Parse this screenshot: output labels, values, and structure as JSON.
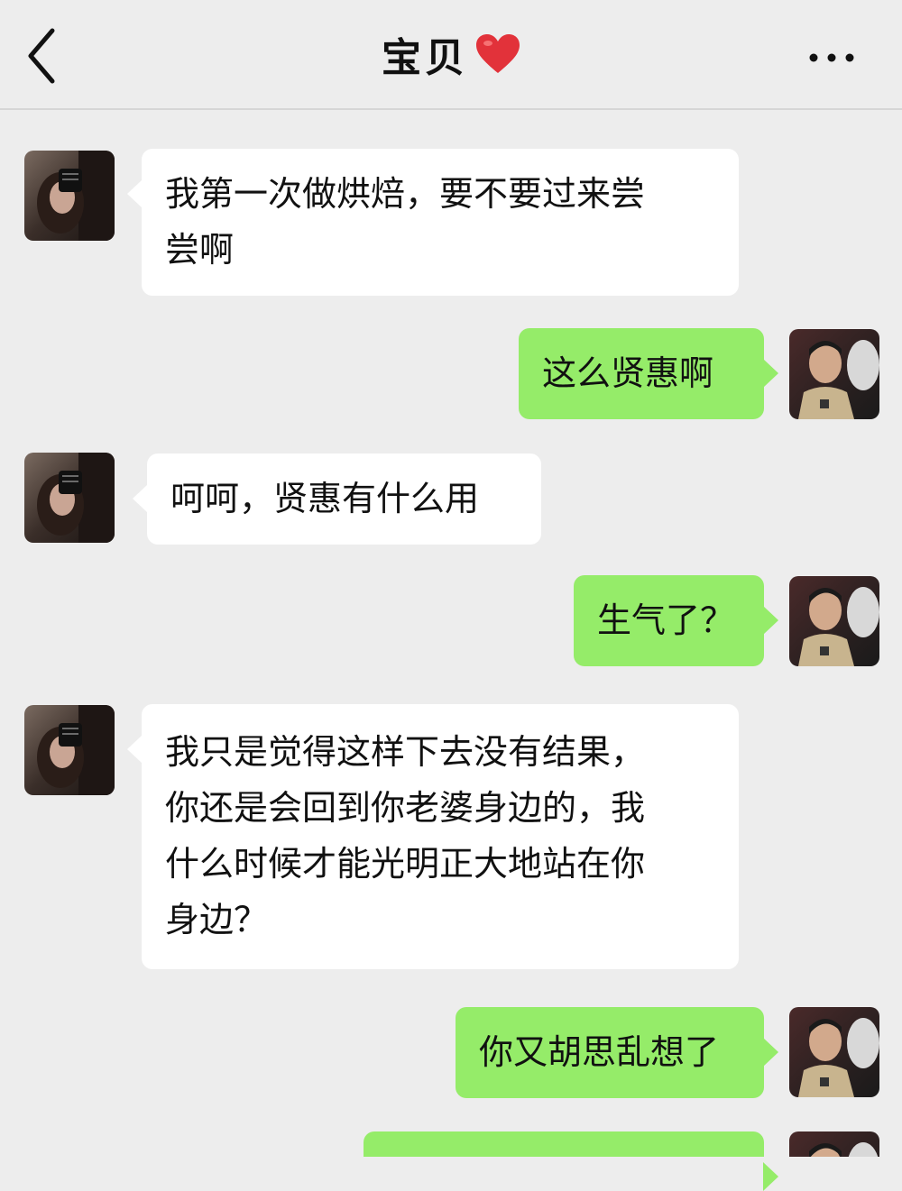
{
  "header": {
    "title": "宝贝",
    "back_icon": "chevron-left-icon",
    "heart_icon": "heart-icon",
    "heart_color": "#e2323a",
    "more_icon": "more-dots-icon"
  },
  "colors": {
    "background": "#ededed",
    "incoming_bubble": "#ffffff",
    "outgoing_bubble": "#95ec69"
  },
  "messages": [
    {
      "side": "left",
      "lines": [
        "我第一次做烘焙，要不要过来尝",
        "尝啊"
      ]
    },
    {
      "side": "right",
      "lines": [
        "这么贤惠啊"
      ]
    },
    {
      "side": "left",
      "lines": [
        "呵呵，贤惠有什么用"
      ]
    },
    {
      "side": "right",
      "lines": [
        "生气了？"
      ]
    },
    {
      "side": "left",
      "lines": [
        "我只是觉得这样下去没有结果，",
        "你还是会回到你老婆身边的，我",
        "什么时候才能光明正大地站在你",
        "身边？"
      ]
    },
    {
      "side": "right",
      "lines": [
        "你又胡思乱想了"
      ]
    },
    {
      "side": "right",
      "lines": [
        ""
      ]
    }
  ]
}
